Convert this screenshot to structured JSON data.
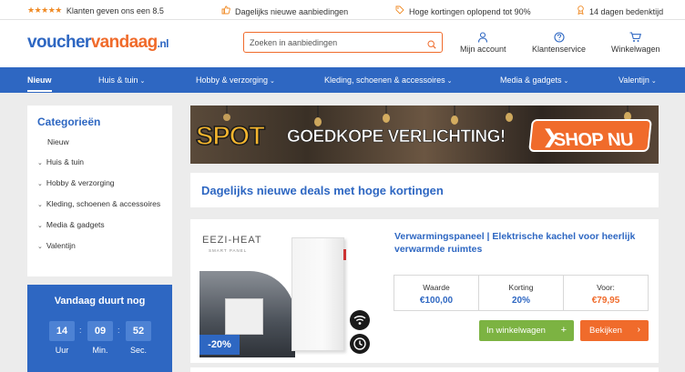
{
  "topbar": {
    "rating_text": "Klanten geven ons een 8.5",
    "deals_text": "Dagelijks nieuwe aanbiedingen",
    "discount_text": "Hoge kortingen oplopend tot 90%",
    "return_text": "14 dagen bedenktijd"
  },
  "header": {
    "logo_part1": "voucher",
    "logo_part2": "vandaag",
    "logo_part3": ".nl",
    "search_placeholder": "Zoeken in aanbiedingen",
    "account_label": "Mijn account",
    "service_label": "Klantenservice",
    "cart_label": "Winkelwagen"
  },
  "nav": {
    "items": [
      "Nieuw",
      "Huis & tuin",
      "Hobby & verzorging",
      "Kleding, schoenen & accessoires",
      "Media & gadgets",
      "Valentijn"
    ]
  },
  "sidebar": {
    "title": "Categorieën",
    "items": [
      "Nieuw",
      "Huis & tuin",
      "Hobby & verzorging",
      "Kleding, schoenen & accessoires",
      "Media & gadgets",
      "Valentijn"
    ]
  },
  "timer": {
    "title": "Vandaag duurt nog",
    "hours": "14",
    "minutes": "09",
    "seconds": "52",
    "hours_label": "Uur",
    "minutes_label": "Min.",
    "seconds_label": "Sec."
  },
  "banner": {
    "spot": "SPOT",
    "text": "GOEDKOPE VERLICHTING!",
    "cta": "SHOP NU"
  },
  "section": {
    "heading": "Dagelijks nieuwe deals met hoge kortingen"
  },
  "deal": {
    "brand": "EEZI-HEAT",
    "brand_sub": "SMART PANEL",
    "discount": "-20%",
    "title": "Verwarmingspaneel | Elektrische kachel voor heerlijk verwarmde ruimtes",
    "value_label": "Waarde",
    "value": "€100,00",
    "korting_label": "Korting",
    "korting": "20%",
    "price_label": "Voor:",
    "price": "€79,95",
    "cart_button": "In winkelwagen",
    "view_button": "Bekijken"
  },
  "colors": {
    "brand_blue": "#2e67c2",
    "accent_orange": "#f06b2b",
    "cart_green": "#7cb342"
  }
}
